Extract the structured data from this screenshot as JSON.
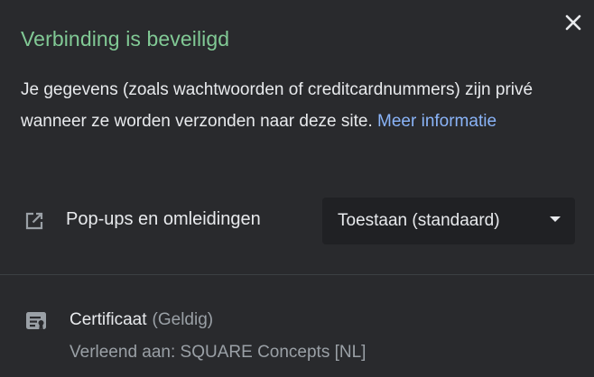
{
  "header": {
    "title": "Verbinding is beveiligd",
    "close_icon": "close-icon"
  },
  "description": {
    "text": "Je gegevens (zoals wachtwoorden of creditcardnummers) zijn privé wanneer ze worden verzonden naar deze site. ",
    "link": "Meer informatie"
  },
  "permissions": [
    {
      "icon": "external-link-icon",
      "label": "Pop-ups en omleidingen",
      "selected": "Toestaan (standaard)"
    }
  ],
  "certificate": {
    "icon": "certificate-icon",
    "title": "Certificaat",
    "status": "(Geldig)",
    "issued_to": "Verleend aan: SQUARE Concepts [NL]"
  },
  "colors": {
    "background": "#292a2d",
    "title_green": "#81c995",
    "link_blue": "#8ab4f8",
    "text": "#e8eaed",
    "secondary_text": "#9aa0a6",
    "select_bg": "#202124"
  }
}
